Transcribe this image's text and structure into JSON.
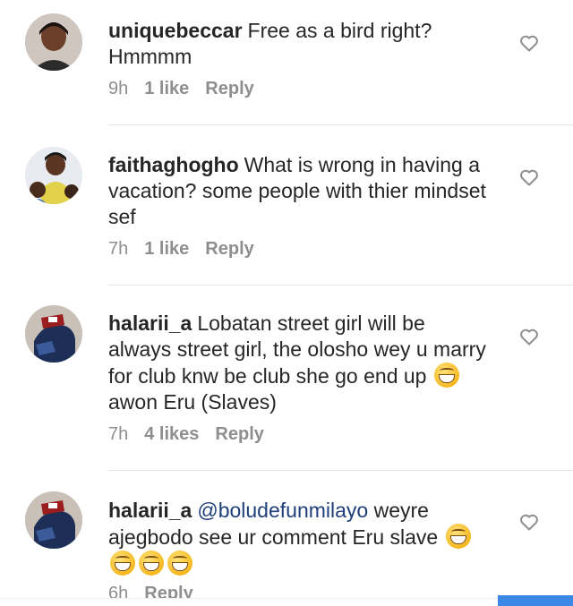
{
  "comments": [
    {
      "username": "uniquebeccar",
      "text": "Free as a bird right? Hmmmm",
      "time": "9h",
      "likes": "1 like",
      "reply": "Reply"
    },
    {
      "username": "faithaghogho",
      "text": "What is wrong in having a vacation? some people with thier mindset sef",
      "time": "7h",
      "likes": "1 like",
      "reply": "Reply"
    },
    {
      "username": "halarii_a",
      "text_before_emoji": "Lobatan street girl will be always street girl, the olosho wey u marry for club knw be club she go end up",
      "emoji": "grinning-face-emoji",
      "text_after_emoji": "awon Eru (Slaves)",
      "time": "7h",
      "likes": "4 likes",
      "reply": "Reply"
    },
    {
      "username": "halarii_a",
      "mention": "@boludefunmilayo",
      "text": "weyre ajegbodo see ur comment Eru slave",
      "emoji_count": 4,
      "time": "6h",
      "reply": "Reply"
    }
  ],
  "colors": {
    "text": "#262626",
    "meta": "#8e8e8e",
    "mention": "#1e3f78",
    "divider": "#e6e6e6",
    "accent_button": "#3b87e6"
  }
}
